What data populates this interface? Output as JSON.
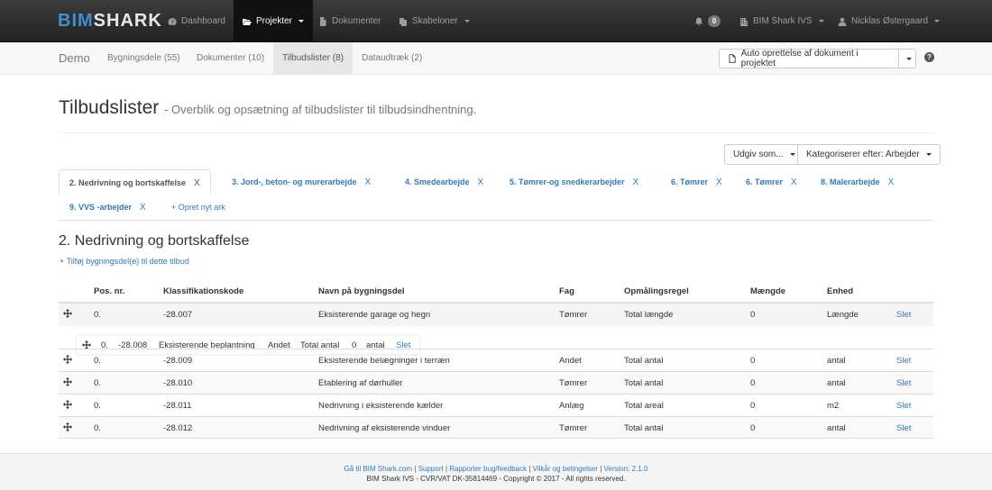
{
  "brand": {
    "part1": "BIM",
    "part2": "SHARK"
  },
  "topnav": {
    "dashboard": "Dashboard",
    "projects": "Projekter",
    "documents": "Dokumenter",
    "templates": "Skabeloner",
    "notifications_count": "0",
    "company": "BIM Shark IVS",
    "user": "Nicklas Østergaard"
  },
  "subnav": {
    "project": "Demo",
    "tabs": [
      "Bygningsdele (55)",
      "Dokumenter (10)",
      "Tilbudslister (8)",
      "Dataudtræk (2)"
    ],
    "active_tab": 2,
    "auto_button": "Auto oprettelse af dokument i projektet",
    "help": "?"
  },
  "page": {
    "title": "Tilbudslister",
    "subtitle": "- Overblik og opsætning af tilbudslister til tilbudsindhentning."
  },
  "actions": {
    "publish": "Udgiv som...",
    "categorize": "Kategoriserer efter: Arbejder"
  },
  "sheets": [
    "2. Nedrivning og bortskaffelse",
    "3. Jord-, beton- og murerarbejde",
    "4. Smedearbejde",
    "5. Tømrer-og snedkerarbejder",
    "6. Tømrer",
    "6. Tømrer",
    "8. Malerarbejde",
    "9. VVS -arbejder"
  ],
  "sheet_close": "X",
  "new_sheet": "+ Opret nyt ark",
  "section": {
    "title": "2. Nedrivning og bortskaffelse",
    "add_link": "+ Tilføj bygningsdel(e) til dette tilbud"
  },
  "table": {
    "headers": [
      "Pos. nr.",
      "Klassifikationskode",
      "Navn på bygningsdel",
      "Fag",
      "Opmålingsregel",
      "Mængde",
      "Enhed"
    ],
    "rows": [
      [
        "0.",
        "-28.007",
        "Eksisterende garage og hegn",
        "Tømrer",
        "Total længde",
        "0",
        "Længde",
        "Slet"
      ],
      [
        "0.",
        "-28.009",
        "Eksisterende belægninger i terræn",
        "Andet",
        "Total antal",
        "0",
        "antal",
        "Slet"
      ],
      [
        "0.",
        "-28.010",
        "Etablering af dørhuller",
        "Tømrer",
        "Total antal",
        "0",
        "antal",
        "Slet"
      ],
      [
        "0.",
        "-28.011",
        "Nedrivning i eksisterende kælder",
        "Anlæg",
        "Total areal",
        "0",
        "m2",
        "Slet"
      ],
      [
        "0.",
        "-28.012",
        "Nedrivning af eksisterende vinduer",
        "Tømrer",
        "Total antal",
        "0",
        "antal",
        "Slet"
      ]
    ],
    "dragging": [
      "0.",
      "-28.008",
      "Eksisterende beplantning",
      "Andet",
      "Total antal",
      "0",
      "antal",
      "Slet"
    ]
  },
  "footer": {
    "links": [
      "Gå til BIM Shark.com",
      "Support",
      "Rapporter bug/feedback",
      "Vilkår og betingelser",
      "Version: 2.1.0"
    ],
    "separator": " | ",
    "copyright": "BIM Shark IVS - CVR/VAT DK-35814469 - Copyright © 2017 - All rights reserved."
  }
}
